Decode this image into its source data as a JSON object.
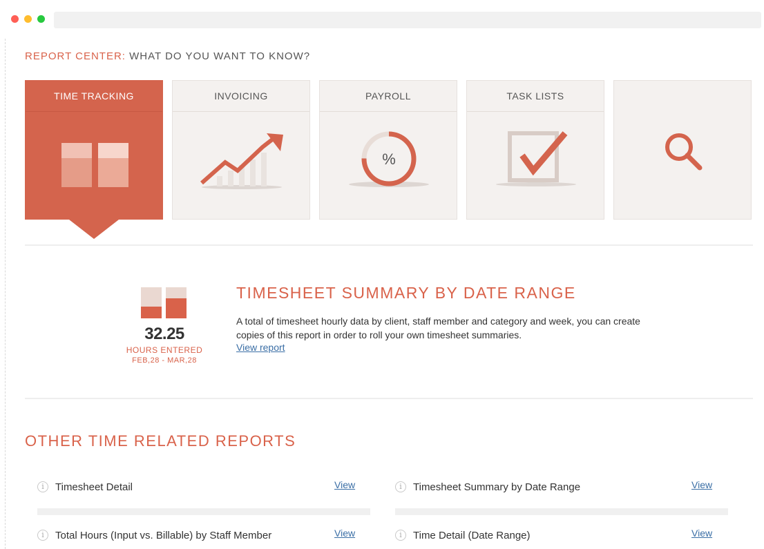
{
  "header": {
    "accent": "REPORT CENTER:",
    "rest": " WHAT DO YOU WANT TO KNOW?"
  },
  "categories": [
    {
      "label": "TIME TRACKING",
      "icon": "time-tracking-icon",
      "active": true
    },
    {
      "label": "INVOICING",
      "icon": "trend-chart-icon",
      "active": false
    },
    {
      "label": "PAYROLL",
      "icon": "percent-donut-icon",
      "active": false
    },
    {
      "label": "TASK LISTS",
      "icon": "checkbox-icon",
      "active": false
    },
    {
      "label": "",
      "icon": "search-icon",
      "active": false
    }
  ],
  "featured": {
    "hours": "32.25",
    "hours_label": "HOURS ENTERED",
    "date_range": "FEB,28 - MAR,28",
    "title": "TIMESHEET SUMMARY BY DATE RANGE",
    "description": "A total of timesheet hourly data by client, staff member and category and week, you can create copies of this report in order to roll your own timesheet summaries.",
    "link": "View report"
  },
  "other_reports": {
    "title": "OTHER TIME RELATED REPORTS",
    "items": [
      {
        "name": "Timesheet Detail",
        "view": "View"
      },
      {
        "name": "Timesheet Summary by Date Range",
        "view": "View"
      },
      {
        "name": "Total Hours (Input vs. Billable) by Staff Member",
        "view": "View"
      },
      {
        "name": "Time Detail (Date Range)",
        "view": "View"
      }
    ]
  },
  "colors": {
    "accent": "#d4644d",
    "card_bg": "#f4f1ef",
    "link": "#3a6ea5"
  }
}
